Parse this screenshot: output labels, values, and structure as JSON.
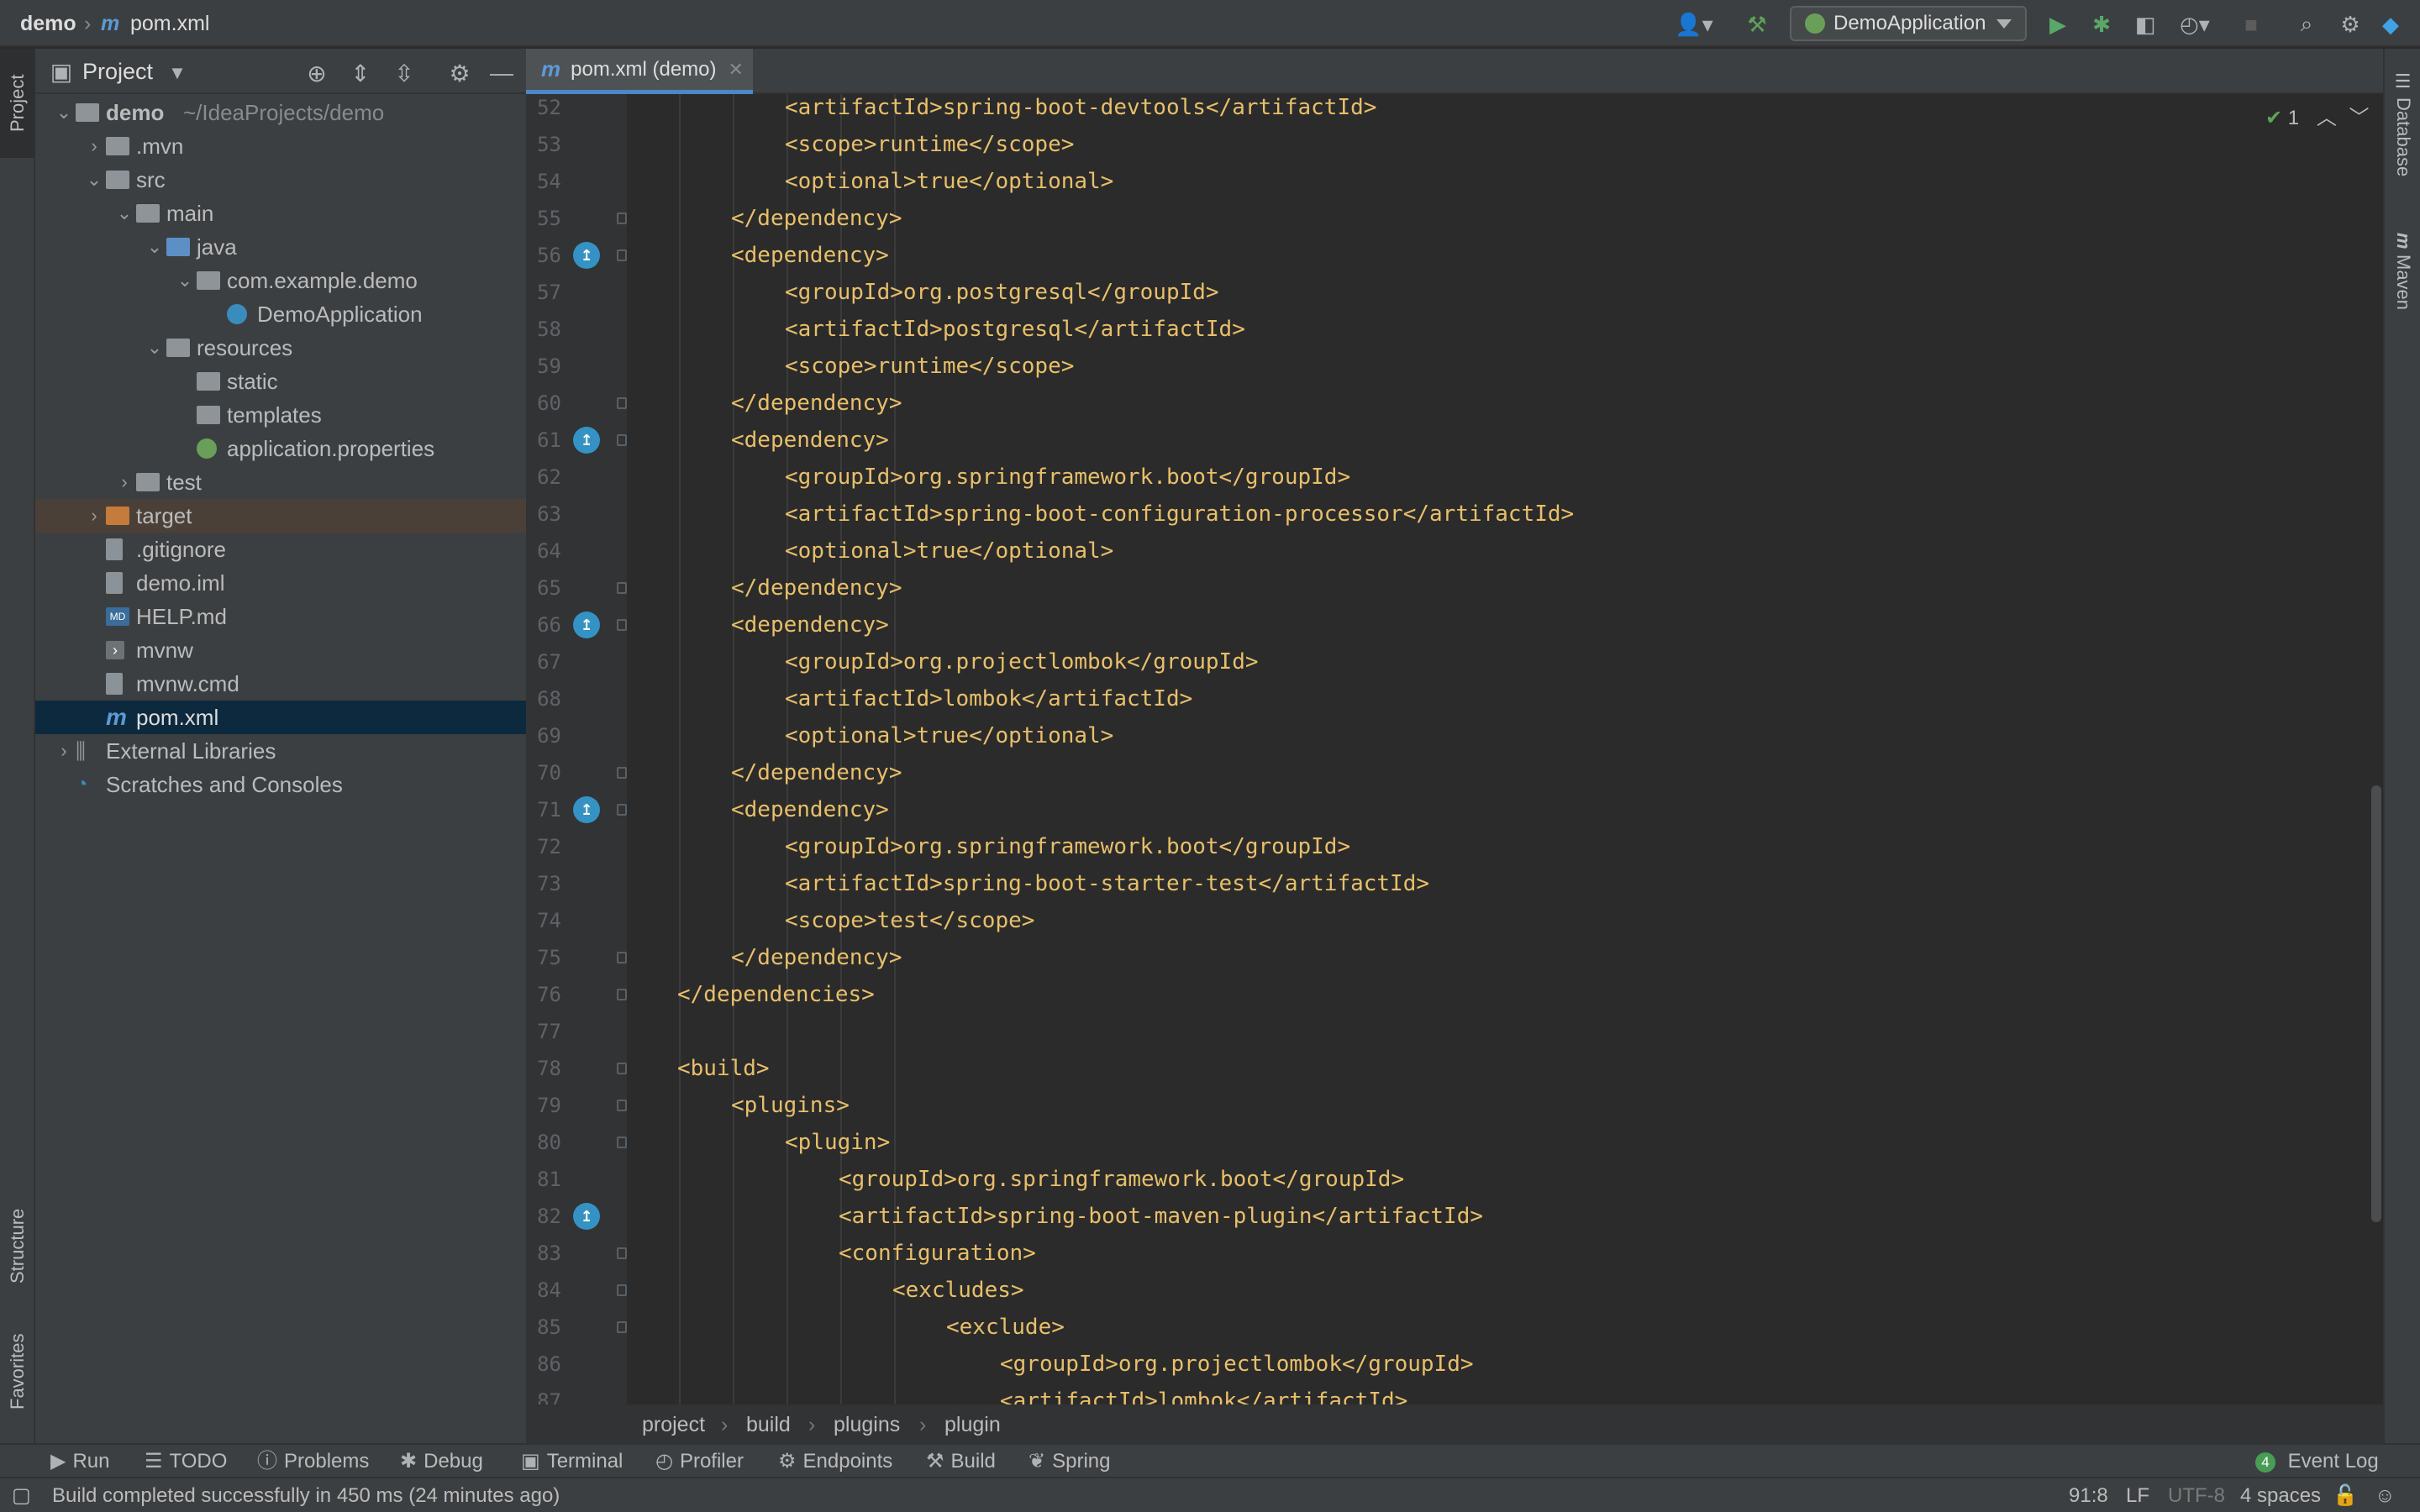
{
  "navbar": {
    "project_name": "demo",
    "file_icon_letter": "m",
    "file_name": "pom.xml",
    "run_config": "DemoApplication",
    "icons": [
      "user-icon",
      "hammer-icon",
      "run-icon",
      "debug-icon",
      "coverage-icon",
      "profile-icon",
      "stop-icon",
      "search-icon",
      "gear-icon",
      "jetbrains-icon"
    ]
  },
  "left_strip": {
    "project_tab": "Project",
    "structure_tab": "Structure",
    "favorites_tab": "Favorites"
  },
  "project_panel": {
    "title": "Project",
    "tree": [
      {
        "label": "demo",
        "sub": "~/IdeaProjects/demo",
        "depth": 0,
        "expanded": true,
        "icon": "folder"
      },
      {
        "label": ".mvn",
        "depth": 1,
        "expanded": false,
        "icon": "folder"
      },
      {
        "label": "src",
        "depth": 1,
        "expanded": true,
        "icon": "folder"
      },
      {
        "label": "main",
        "depth": 2,
        "expanded": true,
        "icon": "folder"
      },
      {
        "label": "java",
        "depth": 3,
        "expanded": true,
        "icon": "folder-blue"
      },
      {
        "label": "com.example.demo",
        "depth": 4,
        "expanded": true,
        "icon": "package"
      },
      {
        "label": "DemoApplication",
        "depth": 5,
        "icon": "spring-class"
      },
      {
        "label": "resources",
        "depth": 3,
        "expanded": true,
        "icon": "folder"
      },
      {
        "label": "static",
        "depth": 4,
        "icon": "folder"
      },
      {
        "label": "templates",
        "depth": 4,
        "icon": "folder"
      },
      {
        "label": "application.properties",
        "depth": 4,
        "icon": "spring-props"
      },
      {
        "label": "test",
        "depth": 2,
        "expanded": false,
        "icon": "folder"
      },
      {
        "label": "target",
        "depth": 1,
        "expanded": false,
        "icon": "folder-orange",
        "state": "excluded"
      },
      {
        "label": ".gitignore",
        "depth": 1,
        "icon": "file"
      },
      {
        "label": "demo.iml",
        "depth": 1,
        "icon": "file"
      },
      {
        "label": "HELP.md",
        "depth": 1,
        "icon": "md-file"
      },
      {
        "label": "mvnw",
        "depth": 1,
        "icon": "script-file"
      },
      {
        "label": "mvnw.cmd",
        "depth": 1,
        "icon": "file"
      },
      {
        "label": "pom.xml",
        "depth": 1,
        "icon": "maven-file",
        "state": "selected"
      },
      {
        "label": "External Libraries",
        "depth": 0,
        "expanded": false,
        "icon": "libraries"
      },
      {
        "label": "Scratches and Consoles",
        "depth": 0,
        "icon": "scratches"
      }
    ]
  },
  "editor": {
    "tab_label": "pom.xml (demo)",
    "tab_icon_letter": "m",
    "tab_close": "✕",
    "inspection": "1",
    "lines": [
      {
        "n": "52",
        "indent": 3,
        "text": "<artifactId>spring-boot-devtools</artifactId>"
      },
      {
        "n": "53",
        "indent": 3,
        "text": "<scope>runtime</scope>"
      },
      {
        "n": "54",
        "indent": 3,
        "text": "<optional>true</optional>"
      },
      {
        "n": "55",
        "indent": 2,
        "text": "</dependency>",
        "fold": true
      },
      {
        "n": "56",
        "indent": 2,
        "text": "<dependency>",
        "fold": true,
        "mark": true
      },
      {
        "n": "57",
        "indent": 3,
        "text": "<groupId>org.postgresql</groupId>"
      },
      {
        "n": "58",
        "indent": 3,
        "text": "<artifactId>postgresql</artifactId>"
      },
      {
        "n": "59",
        "indent": 3,
        "text": "<scope>runtime</scope>"
      },
      {
        "n": "60",
        "indent": 2,
        "text": "</dependency>",
        "fold": true
      },
      {
        "n": "61",
        "indent": 2,
        "text": "<dependency>",
        "fold": true,
        "mark": true
      },
      {
        "n": "62",
        "indent": 3,
        "text": "<groupId>org.springframework.boot</groupId>"
      },
      {
        "n": "63",
        "indent": 3,
        "text": "<artifactId>spring-boot-configuration-processor</artifactId>"
      },
      {
        "n": "64",
        "indent": 3,
        "text": "<optional>true</optional>"
      },
      {
        "n": "65",
        "indent": 2,
        "text": "</dependency>",
        "fold": true
      },
      {
        "n": "66",
        "indent": 2,
        "text": "<dependency>",
        "fold": true,
        "mark": true
      },
      {
        "n": "67",
        "indent": 3,
        "text": "<groupId>org.projectlombok</groupId>"
      },
      {
        "n": "68",
        "indent": 3,
        "text": "<artifactId>lombok</artifactId>"
      },
      {
        "n": "69",
        "indent": 3,
        "text": "<optional>true</optional>"
      },
      {
        "n": "70",
        "indent": 2,
        "text": "</dependency>",
        "fold": true
      },
      {
        "n": "71",
        "indent": 2,
        "text": "<dependency>",
        "fold": true,
        "mark": true
      },
      {
        "n": "72",
        "indent": 3,
        "text": "<groupId>org.springframework.boot</groupId>"
      },
      {
        "n": "73",
        "indent": 3,
        "text": "<artifactId>spring-boot-starter-test</artifactId>"
      },
      {
        "n": "74",
        "indent": 3,
        "text": "<scope>test</scope>"
      },
      {
        "n": "75",
        "indent": 2,
        "text": "</dependency>",
        "fold": true
      },
      {
        "n": "76",
        "indent": 1,
        "text": "</dependencies>",
        "fold": true
      },
      {
        "n": "77",
        "indent": 0,
        "text": ""
      },
      {
        "n": "78",
        "indent": 1,
        "text": "<build>",
        "fold": true
      },
      {
        "n": "79",
        "indent": 2,
        "text": "<plugins>",
        "fold": true
      },
      {
        "n": "80",
        "indent": 3,
        "text": "<plugin>",
        "fold": true
      },
      {
        "n": "81",
        "indent": 4,
        "text": "<groupId>org.springframework.boot</groupId>"
      },
      {
        "n": "82",
        "indent": 4,
        "text": "<artifactId>spring-boot-maven-plugin</artifactId>",
        "mark": true
      },
      {
        "n": "83",
        "indent": 4,
        "text": "<configuration>",
        "fold": true
      },
      {
        "n": "84",
        "indent": 5,
        "text": "<excludes>",
        "fold": true
      },
      {
        "n": "85",
        "indent": 6,
        "text": "<exclude>",
        "fold": true
      },
      {
        "n": "86",
        "indent": 7,
        "text": "<groupId>org.projectlombok</groupId>"
      },
      {
        "n": "87",
        "indent": 7,
        "text": "<artifactId>lombok</artifactId>"
      }
    ],
    "breadcrumbs": [
      "project",
      "build",
      "plugins",
      "plugin"
    ]
  },
  "right_strip": {
    "database_tab": "Database",
    "maven_tab": "Maven"
  },
  "tool_bar": {
    "items": [
      {
        "label": "Run",
        "icon": "▶"
      },
      {
        "label": "TODO",
        "icon": "☰"
      },
      {
        "label": "Problems",
        "icon": "ⓘ"
      },
      {
        "label": "Debug",
        "icon": "✱"
      },
      {
        "label": "Terminal",
        "icon": "▣"
      },
      {
        "label": "Profiler",
        "icon": "◴"
      },
      {
        "label": "Endpoints",
        "icon": "⚙"
      },
      {
        "label": "Build",
        "icon": "⚒"
      },
      {
        "label": "Spring",
        "icon": "❦"
      }
    ],
    "event_log_count": "4",
    "event_log": "Event Log"
  },
  "status_bar": {
    "message": "Build completed successfully in 450 ms (24 minutes ago)",
    "position": "91:8",
    "line_sep": "LF",
    "encoding": "UTF-8",
    "indent": "4 spaces"
  }
}
